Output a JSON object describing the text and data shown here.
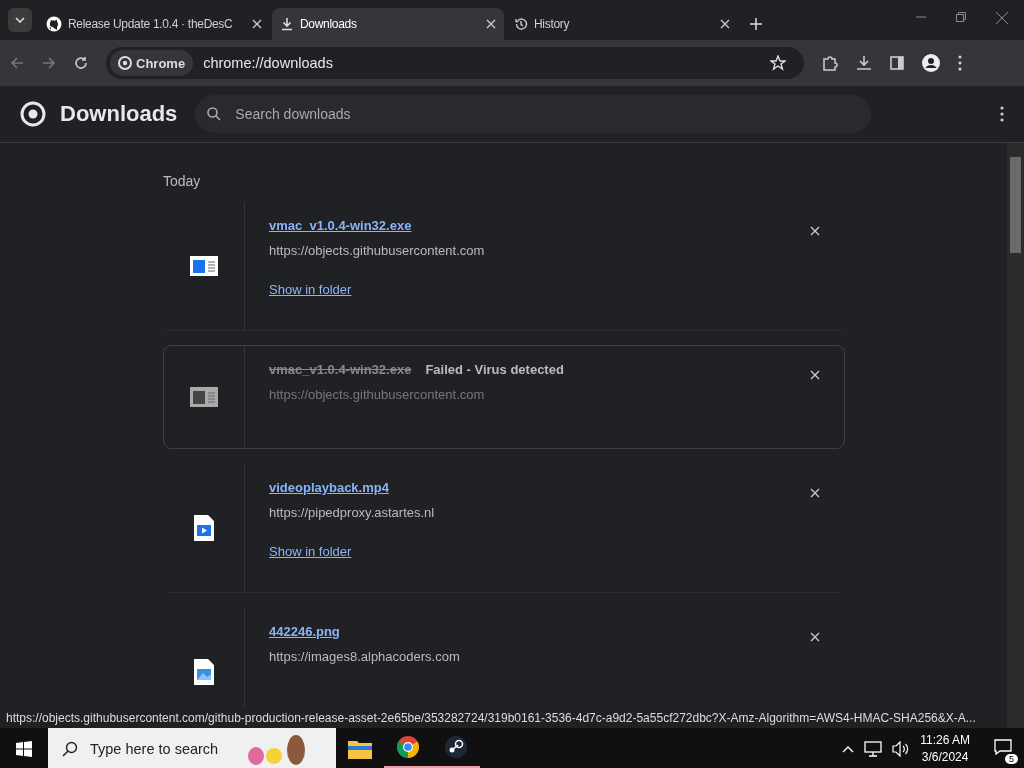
{
  "tabs": [
    {
      "title": "Release Update 1.0.4 · theDesC",
      "selected": false
    },
    {
      "title": "Downloads",
      "selected": true
    },
    {
      "title": "History",
      "selected": false
    }
  ],
  "toolbar": {
    "site_chip": "Chrome",
    "url": "chrome://downloads"
  },
  "header": {
    "title": "Downloads",
    "search": {
      "placeholder": "Search downloads"
    }
  },
  "section": "Today",
  "downloads": [
    {
      "name": "vmac_v1.0.4-win32.exe",
      "source": "https://objects.githubusercontent.com",
      "failed": false,
      "kind": "exe",
      "action": "Show in folder"
    },
    {
      "name": "vmac_v1.0.4-win32.exe",
      "source": "https://objects.githubusercontent.com",
      "failed": true,
      "status": "Failed - Virus detected",
      "kind": "exe"
    },
    {
      "name": "videoplayback.mp4",
      "source": "https://pipedproxy.astartes.nl",
      "failed": false,
      "kind": "video",
      "action": "Show in folder"
    },
    {
      "name": "442246.png",
      "source": "https://images8.alphacoders.com",
      "failed": false,
      "kind": "image"
    }
  ],
  "status_bar": "https://objects.githubusercontent.com/github-production-release-asset-2e65be/353282724/319b0161-3536-4d7c-a9d2-5a55cf272dbc?X-Amz-Algorithm=AWS4-HMAC-SHA256&X-A...",
  "taskbar": {
    "search_placeholder": "Type here to search",
    "apps": [
      {
        "kind": "explorer",
        "selected": false
      },
      {
        "kind": "chrome",
        "selected": true
      },
      {
        "kind": "steam",
        "selected": true
      }
    ],
    "time": "11:26 AM",
    "date": "3/6/2024",
    "notifications": "5"
  }
}
